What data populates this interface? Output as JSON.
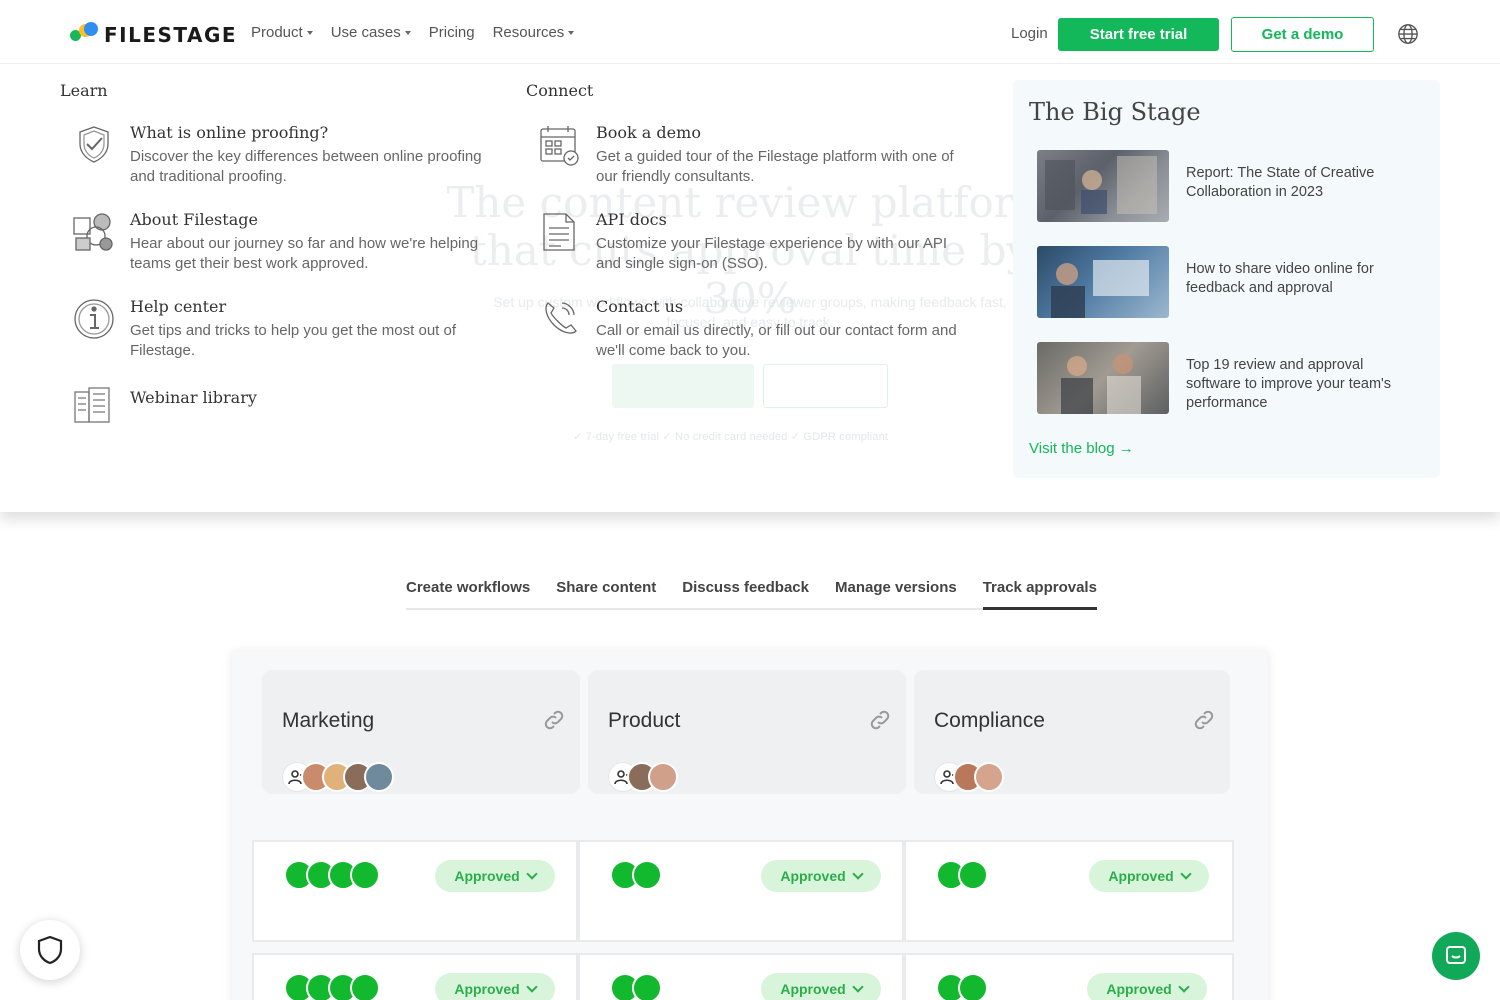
{
  "brand": {
    "name": "FILESTAGE",
    "accent": "#12b85a"
  },
  "nav": {
    "links": [
      {
        "label": "Product",
        "has_caret": true
      },
      {
        "label": "Use cases",
        "has_caret": true
      },
      {
        "label": "Pricing",
        "has_caret": false
      },
      {
        "label": "Resources",
        "has_caret": true
      }
    ],
    "login": "Login",
    "trial": "Start free trial",
    "demo": "Get a demo",
    "globe_icon": "globe-icon"
  },
  "mega_menu": {
    "learn": {
      "title": "Learn",
      "items": [
        {
          "title": "What is online proofing?",
          "desc": "Discover the key differences between online proofing and traditional proofing.",
          "icon": "shield-check-icon"
        },
        {
          "title": "About Filestage",
          "desc": "Hear about our journey so far and how we're helping teams get their best work approved.",
          "icon": "shapes-icon"
        },
        {
          "title": "Help center",
          "desc": "Get tips and tricks to help you get the most out of Filestage.",
          "icon": "info-icon"
        },
        {
          "title": "Webinar library",
          "desc": "",
          "icon": "library-icon"
        }
      ]
    },
    "connect": {
      "title": "Connect",
      "items": [
        {
          "title": "Book a demo",
          "desc": "Get a guided tour of the Filestage platform with one of our friendly consultants.",
          "icon": "calendar-icon"
        },
        {
          "title": "API docs",
          "desc": "Customize your Filestage experience by with our API and single sign-on (SSO).",
          "icon": "document-icon"
        },
        {
          "title": "Contact us",
          "desc": "Call or email us directly, or fill out our contact form and we'll come back to you.",
          "icon": "phone-icon"
        }
      ]
    },
    "blog": {
      "title": "The Big Stage",
      "posts": [
        {
          "title": "Report: The State of Creative Collaboration in 2023"
        },
        {
          "title": "How to share video online for feedback and approval"
        },
        {
          "title": "Top 19 review and approval software to improve your team's performance"
        }
      ],
      "visit": "Visit the blog →"
    },
    "background": {
      "hero": "The content review platform that cuts approval time by 30%",
      "sub": "Set up custom workflows with collaborative reviewer groups, making feedback fast, focused, and easy to track.",
      "checks": "✓ 7-day free trial   ✓ No credit card needed   ✓ GDPR compliant"
    }
  },
  "tabs": [
    {
      "label": "Create workflows",
      "active": false
    },
    {
      "label": "Share content",
      "active": false
    },
    {
      "label": "Discuss feedback",
      "active": false
    },
    {
      "label": "Manage versions",
      "active": false
    },
    {
      "label": "Track approvals",
      "active": true
    }
  ],
  "app": {
    "stages": [
      {
        "name": "Marketing",
        "avatars": 4,
        "dots": 4
      },
      {
        "name": "Product",
        "avatars": 2,
        "dots": 2
      },
      {
        "name": "Compliance",
        "avatars": 2,
        "dots": 2
      }
    ],
    "status_label": "Approved",
    "status_color": "#2bae4a",
    "avatar_colors": [
      "#c98b6b",
      "#e0b27a",
      "#8a6c5a",
      "#6f8a9c"
    ]
  },
  "floating": {
    "shield_icon": "shield-icon",
    "chat_icon": "chat-icon"
  }
}
